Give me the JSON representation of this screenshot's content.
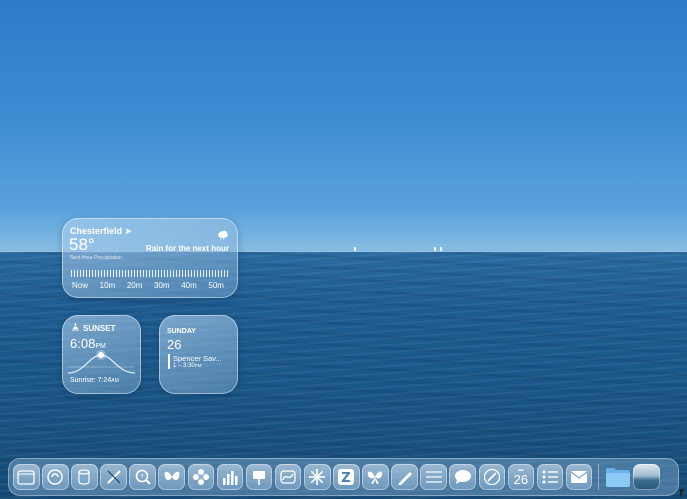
{
  "weather": {
    "city": "Chesterfield",
    "temperature": "58°",
    "condition": "Rain for the next hour",
    "precip_label": "Next-Hour Precipitation",
    "ticks": [
      "Now",
      "10m",
      "20m",
      "30m",
      "40m",
      "50m"
    ],
    "icon": "cloud-rain-icon"
  },
  "sunset": {
    "label": "SUNSET",
    "time": "6:08",
    "meridiem": "PM",
    "sunrise_label": "Sunrise: 7:24",
    "sunrise_meridiem": "AM"
  },
  "calendar": {
    "day": "SUNDAY",
    "date": "26",
    "event_title": "Spencer Sav...",
    "event_time": "1 – 3:30",
    "event_meridiem": "PM"
  },
  "dock": {
    "apps": [
      "finder-icon",
      "launchpad-icon",
      "app-store-icon",
      "pencil-app-icon",
      "search-app-icon",
      "butterfly-icon",
      "flower-icon",
      "stats-icon",
      "keynote-icon",
      "freeform-icon",
      "starburst-icon",
      "z-app-icon",
      "butterfly-2-icon",
      "pen-icon",
      "notes-lines-icon",
      "messages-icon",
      "safari-icon",
      "calendar-icon",
      "reminders-icon",
      "mail-icon",
      "folder-icon",
      "photo-thumbnail-icon"
    ],
    "calendar_day": "26"
  }
}
